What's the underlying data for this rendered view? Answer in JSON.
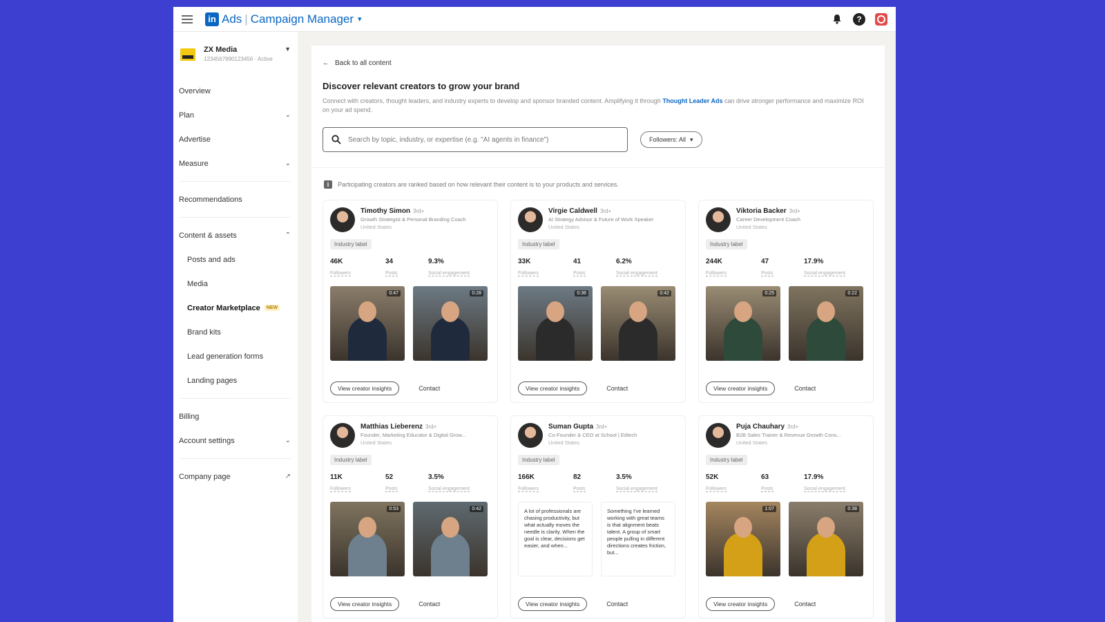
{
  "topbar": {
    "logo": "in",
    "ads": "Ads",
    "app_title": "Campaign Manager"
  },
  "account": {
    "name": "ZX Media",
    "sub": "1234567890123456 · Active"
  },
  "sidebar": {
    "overview": "Overview",
    "plan": "Plan",
    "advertise": "Advertise",
    "measure": "Measure",
    "recommendations": "Recommendations",
    "content_assets": "Content & assets",
    "posts_ads": "Posts and ads",
    "media": "Media",
    "creator_marketplace": "Creator Marketplace",
    "new_badge": "NEW",
    "brand_kits": "Brand kits",
    "lead_forms": "Lead generation forms",
    "landing_pages": "Landing pages",
    "billing": "Billing",
    "account_settings": "Account settings",
    "company_page": "Company page"
  },
  "main": {
    "back": "Back to all content",
    "title": "Discover relevant creators to grow your brand",
    "desc_pre": "Connect with creators, thought leaders, and industry experts to develop and sponsor branded content. Amplifying it through ",
    "desc_link": "Thought Leader Ads",
    "desc_post": " can drive stronger performance and maximize ROI on your ad spend.",
    "search_placeholder": "Search by topic, industry, or expertise (e.g. \"AI agents in finance\")",
    "filter_label": "Followers: All",
    "info": "Participating creators are ranked based on how relevant their content is to your products and services.",
    "industry_label": "Industry label",
    "followers_label": "Followers",
    "posts_label": "Posts",
    "engagement_label": "Social engagement",
    "insights_btn": "View creator insights",
    "contact_btn": "Contact"
  },
  "creators": [
    {
      "name": "Timothy Simon",
      "degree": "3rd+",
      "title": "Growth Strategist & Personal Branding Coach",
      "location": "United States",
      "followers": "46K",
      "posts": "34",
      "engagement": "9.3%",
      "thumbs": [
        {
          "duration": "0:47"
        },
        {
          "duration": "0:28"
        }
      ]
    },
    {
      "name": "Virgie Caldwell",
      "degree": "3rd+",
      "title": "AI Strategy Advisor & Future of Work Speaker",
      "location": "United States",
      "followers": "33K",
      "posts": "41",
      "engagement": "6.2%",
      "thumbs": [
        {
          "duration": "0:36"
        },
        {
          "duration": "0:42"
        }
      ]
    },
    {
      "name": "Viktoria Backer",
      "degree": "3rd+",
      "title": "Career Development Coach",
      "location": "United States",
      "followers": "244K",
      "posts": "47",
      "engagement": "17.9%",
      "thumbs": [
        {
          "duration": "0:25"
        },
        {
          "duration": "0:22"
        }
      ]
    },
    {
      "name": "Matthias Lieberenz",
      "degree": "3rd+",
      "title": "Founder, Marketing Educator & Digital Grow...",
      "location": "United States",
      "followers": "11K",
      "posts": "52",
      "engagement": "3.5%",
      "thumbs": [
        {
          "duration": "0:53"
        },
        {
          "duration": "0:42"
        }
      ]
    },
    {
      "name": "Suman Gupta",
      "degree": "3rd+",
      "title": "Co-Founder & CEO at School | Edtech",
      "location": "United States",
      "followers": "166K",
      "posts": "82",
      "engagement": "3.5%",
      "thumbs": [
        {
          "text": "A lot of professionals are chasing productivity, but what actually moves the needle is clarity. When the goal is clear, decisions get easier, and when..."
        },
        {
          "text": "Something I've learned working with great teams is that alignment beats talent. A group of smart people pulling in different directions creates friction, but..."
        }
      ]
    },
    {
      "name": "Puja Chauhary",
      "degree": "3rd+",
      "title": "B2B Sales Trainer & Revenue Growth Cons...",
      "location": "United States",
      "followers": "52K",
      "posts": "63",
      "engagement": "17.9%",
      "thumbs": [
        {
          "duration": "1:07"
        },
        {
          "duration": "0:38"
        }
      ]
    }
  ]
}
